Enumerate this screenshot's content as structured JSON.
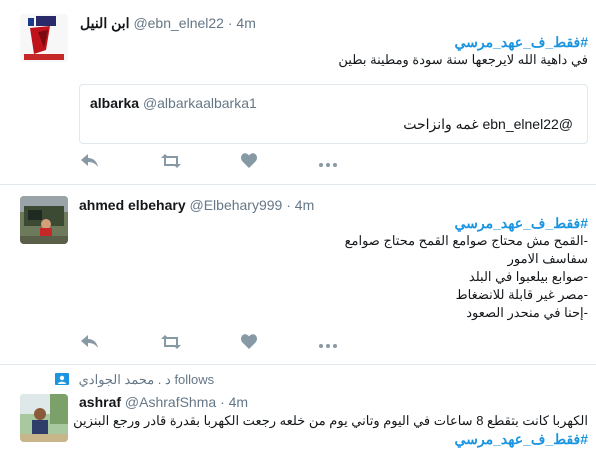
{
  "tweets": [
    {
      "name": "ابن النيل",
      "handle": "@ebn_elnel22",
      "time": "4m",
      "hashtag": "#فقط_ف_عهد_مرسي",
      "text": "في داهية الله لايرجعها سنة سودة ومطينة بطين",
      "quote": {
        "name": "albarka",
        "handle": "@albarkaalbarka1",
        "text": "@ebn_elnel22 غمه وانزاحت"
      }
    },
    {
      "name": "ahmed elbehary",
      "handle": "@Elbehary999",
      "time": "4m",
      "hashtag": "#فقط_ف_عهد_مرسي",
      "lines": [
        "-القمح مش محتاج صوامع القمح محتاج صوامع",
        "سفاسف الامور",
        "-صوابع بيلعبوا في البلد",
        "-مصر غير قابلة للانضغاط",
        "-إحنا في منحدر الصعود"
      ]
    },
    {
      "follows_name": "د . محمد الجوادي",
      "follows_label": "follows",
      "name": "ashraf",
      "handle": "@AshrafShma",
      "time": "4m",
      "text": "الكهربا كانت بتقطع 8 ساعات في اليوم وتاني يوم من خلعه رجعت الكهربا بقدرة قادر ورجع البنزين",
      "hashtag": "#فقط_ف_عهد_مرسي"
    }
  ],
  "dot": "·",
  "colors": {
    "link": "#1b95e0",
    "muted": "#657786",
    "icon": "#8899a6",
    "border": "#e1e8ed"
  }
}
